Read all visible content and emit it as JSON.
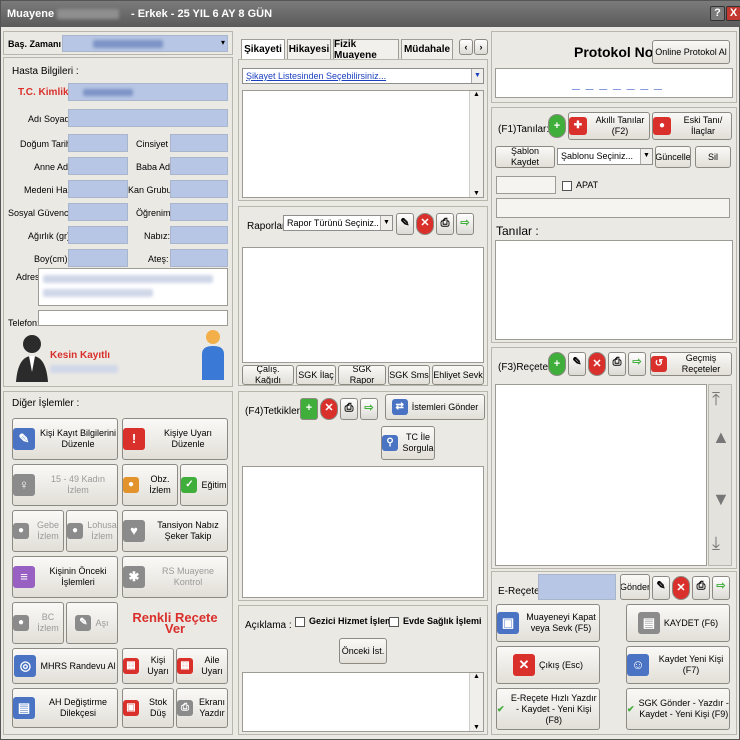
{
  "title": {
    "app": "Muayene",
    "patient": "- Erkek - 25 YIL 6 AY 8 GÜN",
    "help": "?",
    "close": "X"
  },
  "left": {
    "bas_zamani_label": "Baş. Zamanı :",
    "hasta_bilgileri_label": "Hasta Bilgileri :",
    "tc_label": "T.C. Kimlik",
    "adi_soyadi_label": "Adı Soyadı:",
    "dogum_label": "Doğum Tarihi",
    "cinsiyet_label": "Cinsiyet",
    "anne_label": "Anne Adı",
    "baba_label": "Baba Adı",
    "medeni_label": "Medeni Hali",
    "kan_label": "Kan Grubu",
    "sosyal_label": "Sosyal Güvence",
    "ogrenim_label": "Öğrenim",
    "agirlik_label": "Ağırlık (gr):",
    "nabiz_label": "Nabız:",
    "boy_label": "Boy(cm):",
    "ates_label": "Ateş:",
    "adres_label": "Adres",
    "telefon_label": "Telefon:",
    "kesin_kayitli": "Kesin Kayıtlı"
  },
  "diger": {
    "title": "Diğer İşlemler :",
    "kisi_kayit": "Kişi Kayıt Bilgilerini Düzenle",
    "kisiye_uyari": "Kişiye Uyarı Düzenle",
    "kadin_izlem": "15 - 49 Kadın İzlem",
    "obz_izlem": "Obz. İzlem",
    "egitim": "Eğitim",
    "gebe_izlem": "Gebe İzlem",
    "lohusa_izlem": "Lohusa İzlem",
    "tansiyon": "Tansiyon Nabız Şeker Takip",
    "onceki_islemler": "Kişinin Önceki İşlemleri",
    "rs_muayene": "RS Muayene Kontrol",
    "bc_izlem": "BC İzlem",
    "asi": "Aşı",
    "renkli_recete": "Renkli Reçete Ver",
    "mhrs": "MHRS Randevu Al",
    "kisi_uyari": "Kişi Uyarı",
    "aile_uyari": "Aile Uyarı",
    "ah_degistirme": "AH Değiştirme Dilekçesi",
    "stok_dus": "Stok Düş",
    "ekrani_yazdir": "Ekranı Yazdır"
  },
  "middle": {
    "tabs": [
      "Şikayeti",
      "Hikayesi",
      "Fizik Muayene",
      "Müdahale"
    ],
    "sikayet_combo": "Şikayet Listesinden Seçebilirsiniz...",
    "raporlar_label": "Raporlar",
    "rapor_combo": "Rapor Türünü Seçiniz..",
    "report_tabs": [
      "Çalış. Kağıdı",
      "SGK İlaç",
      "SGK Rapor",
      "SGK Sms",
      "Ehliyet Sevk"
    ],
    "tetkikler_label": "(F4)Tetkikler",
    "istemleri_gonder": "İstemleri Gönder",
    "tc_ile_sorgula": "TC İle Sorgula",
    "aciklama_label": "Açıklama :",
    "gezici": "Gezici Hizmet İşlemi",
    "evde_saglik": "Evde Sağlık İşlemi",
    "onceki_ist": "Önceki İst."
  },
  "right": {
    "protokol_no": "Protokol No",
    "online_protokol": "Online Protokol Al",
    "protokol_value": "_ _ _ _ _ _ _",
    "tanilar_f1": "(F1)Tanılar:",
    "akilli_tanilar": "Akıllı Tanılar (F2)",
    "eski_tani": "Eski Tanı/İlaçlar",
    "sablon_kaydet": "Şablon Kaydet",
    "sablon_combo": "Şablonu Seçiniz...",
    "guncelle": "Güncelle",
    "sil": "Sil",
    "apat": "APAT",
    "tanilar_label": "Tanılar :",
    "recete_f3": "(F3)Reçete:",
    "gecmis_receteler": "Geçmiş Reçeteler",
    "e_recete": "E-Reçete:",
    "gonder": "Gönder",
    "muayeneyi_kapat": "Muayeneyi Kapat veya Sevk (F5)",
    "kaydet": "KAYDET (F6)",
    "cikis": "Çıkış (Esc)",
    "kaydet_yeni": "Kaydet Yeni Kişi (F7)",
    "e_recete_hizli": "E-Reçete Hızlı Yazdır - Kaydet - Yeni Kişi (F8)",
    "sgk_gonder": "SGK Gönder - Yazdır - Kaydet - Yeni Kişi (F9)"
  },
  "colors": {
    "accent_red": "#d9302c",
    "field_blue": "#b7c6e4",
    "title_gray": "#6a6a6a"
  }
}
